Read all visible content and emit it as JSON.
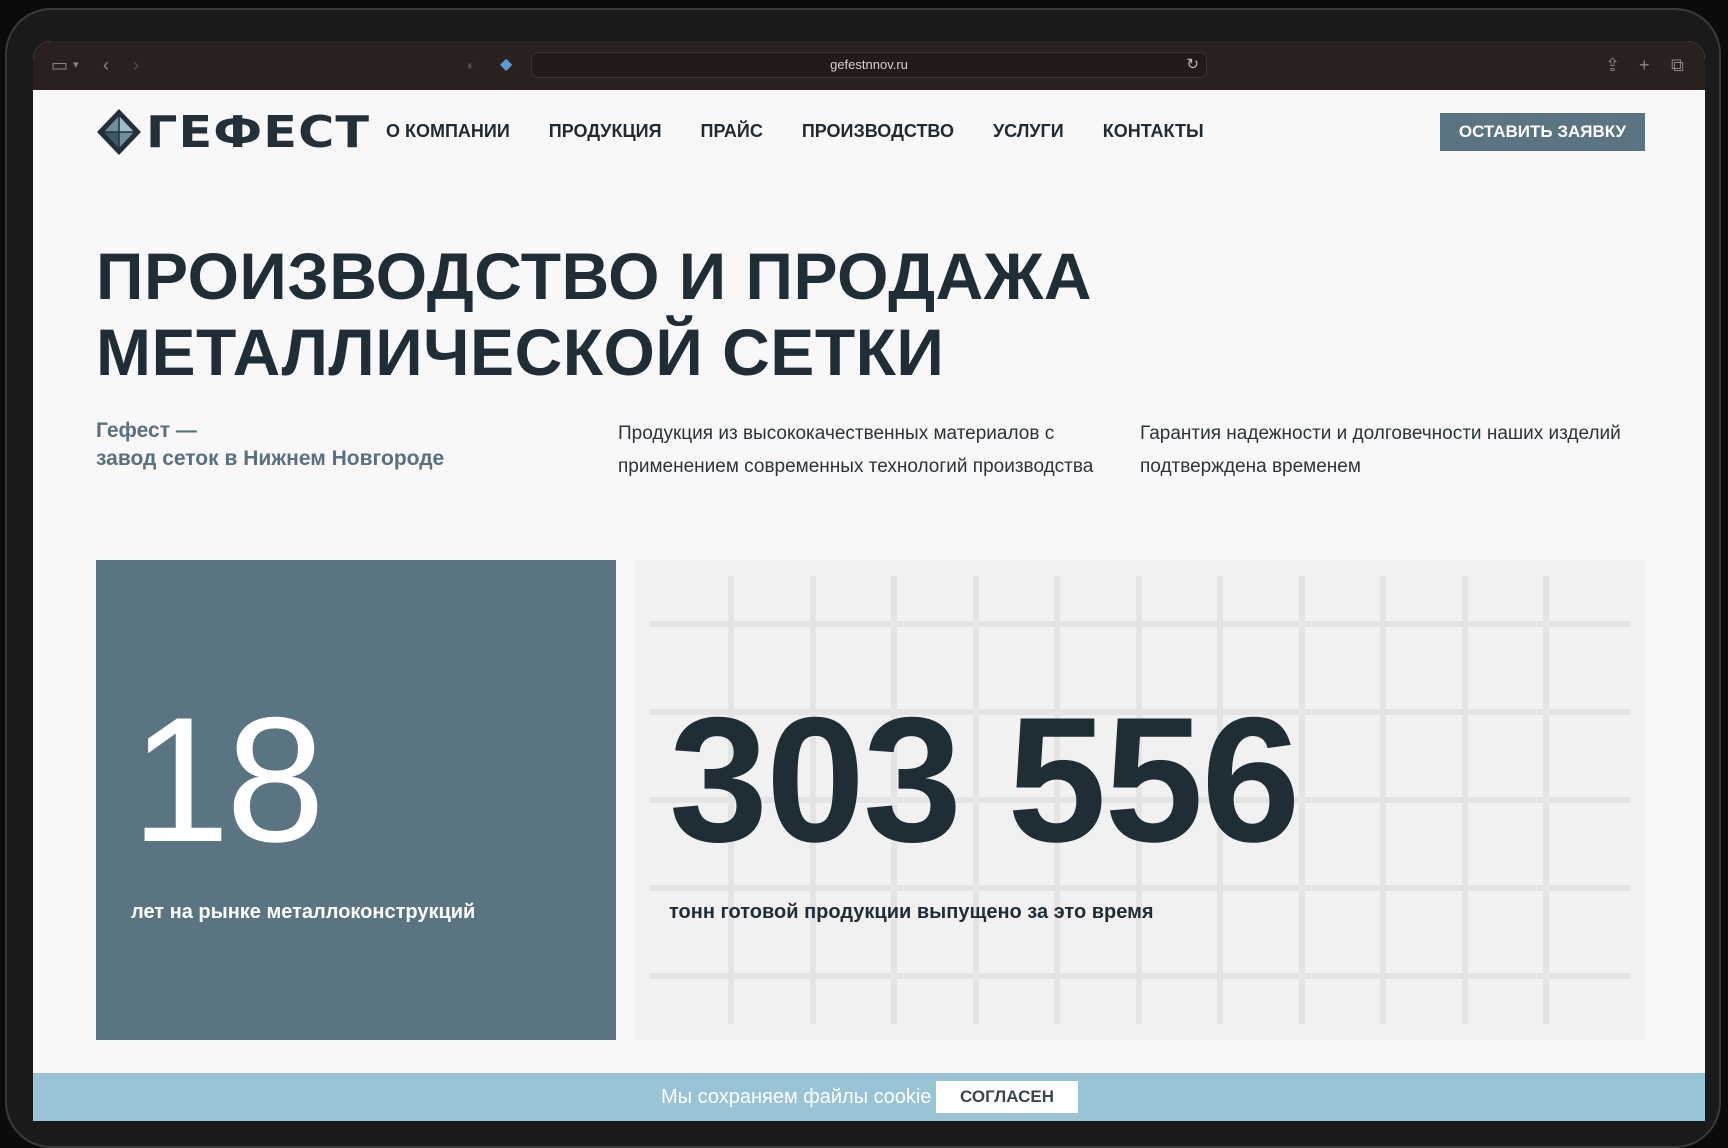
{
  "browser": {
    "url": "gefestnnov.ru"
  },
  "header": {
    "logo_text": "ГЕФЕСТ",
    "nav": [
      {
        "label": "О КОМПАНИИ"
      },
      {
        "label": "ПРОДУКЦИЯ"
      },
      {
        "label": "ПРАЙС"
      },
      {
        "label": "ПРОИЗВОДСТВО"
      },
      {
        "label": "УСЛУГИ"
      },
      {
        "label": "КОНТАКТЫ"
      }
    ],
    "cta_label": "ОСТАВИТЬ ЗАЯВКУ"
  },
  "hero": {
    "title_line1": "ПРОИЗВОДСТВО И ПРОДАЖА",
    "title_line2": "МЕТАЛЛИЧЕСКОЙ СЕТКИ",
    "subtitle_line1": "Гефест —",
    "subtitle_line2": "завод сеток в Нижнем Новгороде",
    "text_2": "Продукция из высококачественных материалов с применением современных технологий производства",
    "text_3": "Гарантия надежности и долговечности наших изделий подтверждена временем"
  },
  "stats": {
    "years": {
      "value": "18",
      "caption": "лет на рынке металлоконструкций"
    },
    "tonnage": {
      "value": "303 556",
      "caption": "тонн готовой продукции выпущено за это время"
    }
  },
  "cookie": {
    "text": "Мы сохраняем файлы cookie",
    "button": "СОГЛАСЕН"
  },
  "colors": {
    "accent": "#5a7581",
    "dark": "#1f2d36",
    "cookie_bar": "#98c4d6"
  }
}
